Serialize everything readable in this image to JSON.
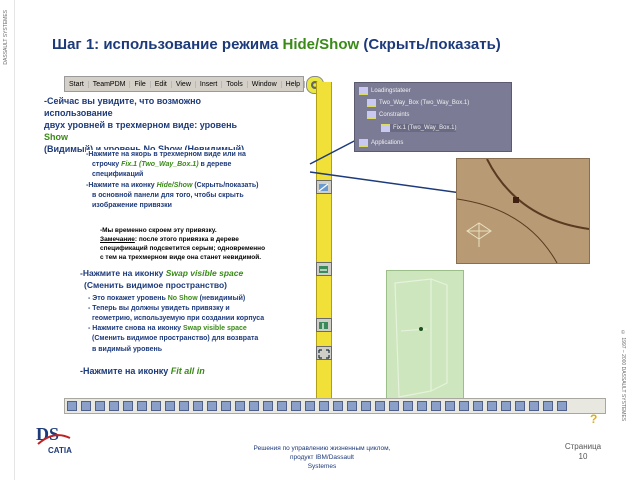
{
  "slide": {
    "title_prefix": "Шаг 1: использование режима ",
    "title_highlight": "Hide/Show",
    "title_suffix": " (Скрыть/показать)",
    "side_company": "DASSAULT SYSTEMES",
    "side_copyright": "© 1997 – 2000 DASSAULT SYSTEMES"
  },
  "menu": {
    "items": [
      "Start",
      "TeamPDM",
      "File",
      "Edit",
      "View",
      "Insert",
      "Tools",
      "Window",
      "Help"
    ]
  },
  "tree": {
    "items": [
      "Loadingstateer",
      "Two_Way_Box (Two_Way_Box.1)",
      "Constraints",
      "Fix.1 (Two_Way_Box.1)",
      "Applications"
    ]
  },
  "text": {
    "line1": "-Сейчас вы увидите, что возможно",
    "line2": "использование",
    "line3": "двух уровней в трехмерном виде: уровень",
    "line4_show": "Show",
    "line5": "(Видимый) и уровень No Show (Невидимый)",
    "b1_1": "-Нажмите на якорь в трехмерном виде или на",
    "b1_2_pre": "строчку ",
    "b1_2_hl": "Fix.1 (Two_Way_Box.1)",
    "b1_2_post": " в дереве",
    "b1_3": "спецификаций",
    "b1_4_pre": "-Нажмите на иконку ",
    "b1_4_hl": "Hide/Show",
    "b1_4_post": " (Скрыть/показать)",
    "b1_5": "в основной панели для того, чтобы скрыть",
    "b1_6": "изображение привязки",
    "n1": "-Мы временно скроем эту привязку.",
    "n2_pre": "Замечание",
    "n2_post": ": после этого привязка в дереве",
    "n3": "спецификаций подсветится серым; одновременно",
    "n4": "с тем на трехмерном виде она станет невидимой.",
    "s1_pre": "-Нажмите на иконку ",
    "s1_hl": "Swap visible space",
    "s2": "(Сменить видимое пространство)",
    "d1_pre": "- Это покажет уровень ",
    "d1_hl": "No Show",
    "d1_post": " (невидимый)",
    "d2": "- Теперь вы должны увидеть привязку и",
    "d3": "геометрию, используемую при создании корпуса",
    "d4_pre": "- Нажмите снова на иконку ",
    "d4_hl": "Swap visible space",
    "d5": "(Сменить видимое пространство) для возврата",
    "d6": "в видимый уровень",
    "f1_pre": "-Нажмите на иконку ",
    "f1_hl": "Fit all in"
  },
  "footer": {
    "line1": "Решения по управлению жизненным циклом, продукт IBM/Dassault",
    "line2": "Systemes",
    "page_label": "Страница",
    "page_number": "10",
    "logo_text": "CATIA"
  },
  "colors": {
    "title": "#1d3a7a",
    "accent_green": "#3a8a18",
    "toolbar_yellow": "#f0e038"
  }
}
